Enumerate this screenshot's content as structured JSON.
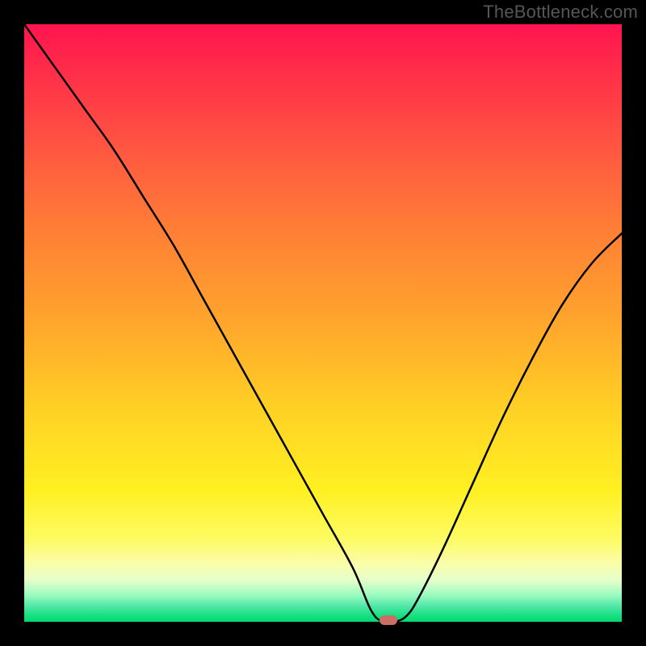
{
  "watermark": "TheBottleneck.com",
  "colors": {
    "frame": "#000000",
    "curve": "#000000",
    "marker": "#cb6e65"
  },
  "chart_data": {
    "type": "line",
    "title": "",
    "xlabel": "",
    "ylabel": "",
    "xlim": [
      0,
      100
    ],
    "ylim": [
      0,
      100
    ],
    "grid": false,
    "series": [
      {
        "name": "bottleneck-curve",
        "x": [
          0,
          5,
          10,
          15,
          20,
          25,
          30,
          35,
          40,
          45,
          50,
          55,
          58,
          60,
          62,
          64,
          66,
          70,
          75,
          80,
          85,
          90,
          95,
          100
        ],
        "y": [
          100,
          93,
          86,
          79,
          71,
          63,
          54,
          45,
          36,
          27,
          18,
          9,
          2,
          0,
          0,
          1,
          4,
          12,
          23,
          34,
          44,
          53,
          60,
          65
        ]
      }
    ],
    "marker": {
      "x": 61,
      "y": 0
    },
    "background_gradient": {
      "top": "#ff1450",
      "mid": "#ffd224",
      "bottom": "#00d873"
    }
  }
}
